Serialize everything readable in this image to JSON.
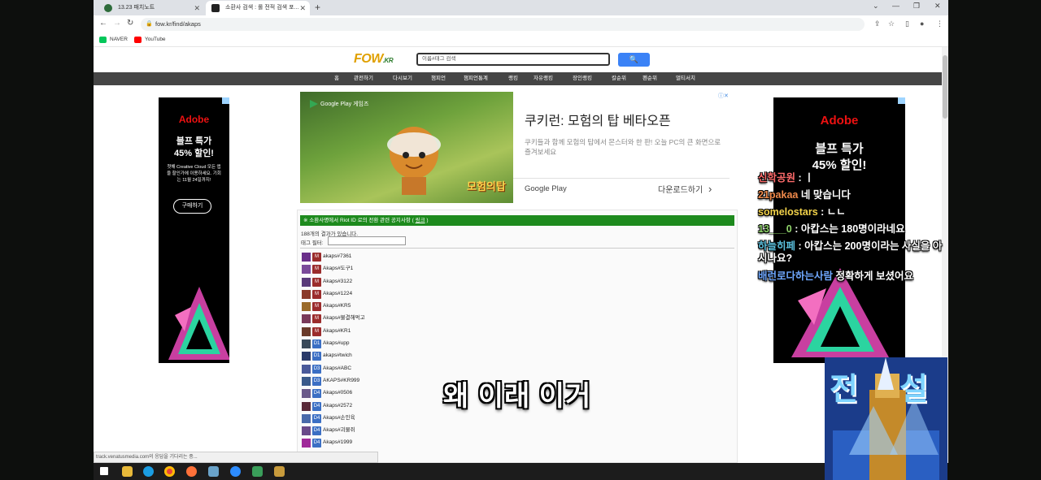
{
  "browser": {
    "tabs": [
      {
        "title": "13.23 패치노트",
        "active": false
      },
      {
        "title": "소환사 검색 : 롤 전적 검색 포...",
        "active": true
      }
    ],
    "new_tab_glyph": "+",
    "window_controls": [
      "⌄",
      "—",
      "❐",
      "✕"
    ],
    "url": "fow.kr/find/akaps",
    "bookmarks": [
      {
        "label": "NAVER",
        "icon": "naver-icon",
        "color": "#03c75a"
      },
      {
        "label": "YouTube",
        "icon": "youtube-icon",
        "color": "#ff0000"
      }
    ],
    "status_text": "track.venatusmedia.com의 응답을 기다리는 중..."
  },
  "site": {
    "logo_text": "FOW",
    "logo_suffix": ".KR",
    "search_placeholder": "이름#태그 검색",
    "search_icon": "🔍",
    "menu": [
      "홈",
      "관전하기",
      "다시보기",
      "챔피언",
      "챔피언통계",
      "랭킹",
      "자유랭킹",
      "장인랭킹",
      "칼순위",
      "펜순위",
      "멀티서치"
    ]
  },
  "ads": {
    "adobe": {
      "brand": "Adobe",
      "headline_1": "블프 특가",
      "headline_2": "45% 할인!",
      "body_left": "첫해 Creative Cloud 모든 앱을 할인가에 이용하세요. 기회는 11월 24일까지!",
      "cta": "구매하기"
    },
    "google_play": {
      "badge": "Google Play 게임즈",
      "image_caption": "모험의탑",
      "title": "쿠키런: 모험의 탑 베타오픈",
      "description": "쿠키들과 함께 모험의 탑에서 몬스터와 한 판! 오늘 PC의 큰 화면으로 즐겨보세요",
      "store": "Google Play",
      "download": "다운로드하기",
      "chevron": "›"
    }
  },
  "results": {
    "notice_prefix": "※ 소환사명에서 Riot ID 로의 전환 관련 공지사항 ( ",
    "notice_link": "링크",
    "notice_suffix": " )",
    "count_text": "188개의 결과가 있습니다.",
    "filter_label": "태그 필터:",
    "rows": [
      {
        "tier": "M",
        "name": "akaps#7361"
      },
      {
        "tier": "M",
        "name": "Akaps#도구1"
      },
      {
        "tier": "M",
        "name": "Akaps#3122"
      },
      {
        "tier": "M",
        "name": "Akaps#1224"
      },
      {
        "tier": "M",
        "name": "Akaps#KR5"
      },
      {
        "tier": "M",
        "name": "Akaps#불결해먹고"
      },
      {
        "tier": "M",
        "name": "Akaps#KR1"
      },
      {
        "tier": "D1",
        "name": "Akaps#upp"
      },
      {
        "tier": "D1",
        "name": "akaps#twich"
      },
      {
        "tier": "D3",
        "name": "Akaps#ABC"
      },
      {
        "tier": "D3",
        "name": "AKAPS#KR999"
      },
      {
        "tier": "D4",
        "name": "Akaps#0506"
      },
      {
        "tier": "D4",
        "name": "Akaps#2572"
      },
      {
        "tier": "D4",
        "name": "Akaps#손인육"
      },
      {
        "tier": "D4",
        "name": "Akaps#괴물쥐"
      },
      {
        "tier": "D4",
        "name": "Akaps#1999"
      }
    ]
  },
  "stream": {
    "chat": [
      {
        "user": "신학공원",
        "sep": " : ",
        "text": "ㅣ",
        "color": "#ff6b6b"
      },
      {
        "user": "21pakaa",
        "sep": " ",
        "text": "네 맞습니다",
        "color": "#f08a4b"
      },
      {
        "user": "somelostars",
        "sep": " : ",
        "text": "ㄴㄴ",
        "color": "#f3d34a"
      },
      {
        "user": "13___0",
        "sep": " : ",
        "text": "아캅스는 180명이라네요",
        "color": "#8fd36a"
      },
      {
        "user": "하늘히페",
        "sep": " : ",
        "text": "아캅스는 200명이라는 사실을 아시나요?",
        "color": "#5bc0de"
      },
      {
        "user": "배런로다하는사람",
        "sep": " ",
        "text": "정확하게 보셨어요",
        "color": "#6fa8ff"
      }
    ],
    "subtitle": "왜 이래 이거",
    "cam_text_1": "전",
    "cam_text_2": "설"
  },
  "colors": {
    "notice_green": "#1d8a1d",
    "menu_bg": "#454545",
    "search_button": "#3b82f6",
    "tier_master": "#9b2c2c",
    "tier_diamond": "#3b6fc4"
  }
}
